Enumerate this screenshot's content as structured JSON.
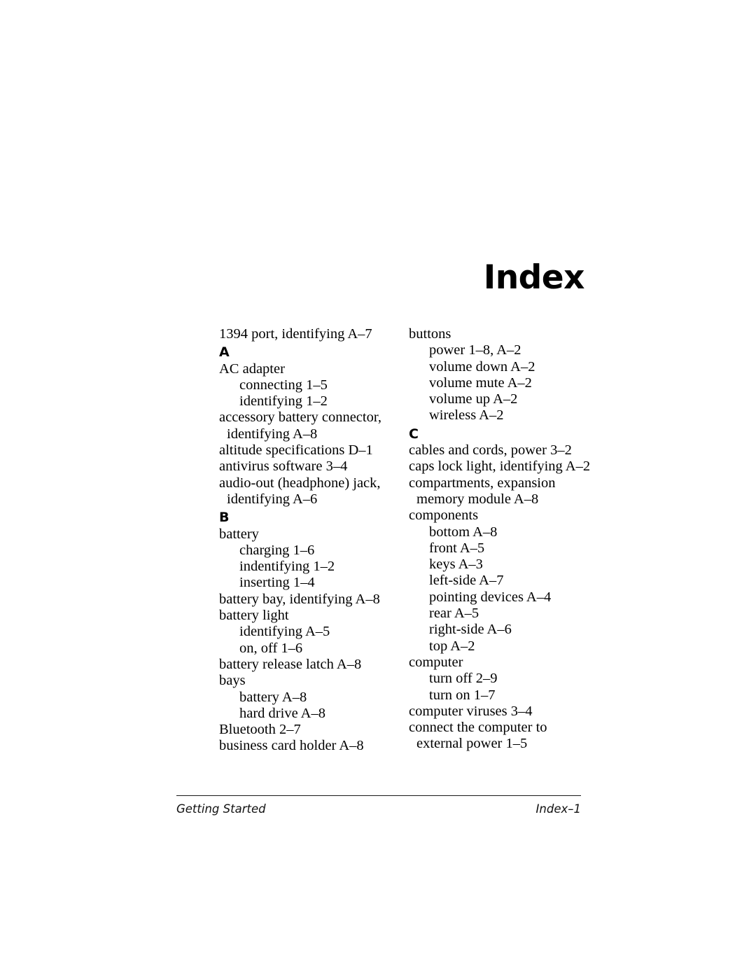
{
  "page": {
    "title": "Index",
    "document_name": "Getting Started",
    "page_number": "Index–1"
  },
  "index": {
    "columns": [
      {
        "name": "left",
        "blocks": [
          {
            "kind": "entry",
            "level": "main",
            "text": "1394 port, identifying A–7"
          },
          {
            "kind": "heading",
            "text": "A"
          },
          {
            "kind": "entry",
            "level": "main",
            "text": "AC adapter"
          },
          {
            "kind": "entry",
            "level": "sub",
            "text": "connecting 1–5"
          },
          {
            "kind": "entry",
            "level": "sub",
            "text": "identifying 1–2"
          },
          {
            "kind": "entry",
            "level": "main",
            "text": "accessory battery connector, identifying A–8"
          },
          {
            "kind": "entry",
            "level": "main",
            "text": "altitude specifications D–1"
          },
          {
            "kind": "entry",
            "level": "main",
            "text": "antivirus software 3–4"
          },
          {
            "kind": "entry",
            "level": "main",
            "text": "audio-out (headphone) jack, identifying A–6"
          },
          {
            "kind": "heading",
            "text": "B"
          },
          {
            "kind": "entry",
            "level": "main",
            "text": "battery"
          },
          {
            "kind": "entry",
            "level": "sub",
            "text": "charging 1–6"
          },
          {
            "kind": "entry",
            "level": "sub",
            "text": "indentifying 1–2"
          },
          {
            "kind": "entry",
            "level": "sub",
            "text": "inserting 1–4"
          },
          {
            "kind": "entry",
            "level": "main",
            "text": "battery bay, identifying A–8"
          },
          {
            "kind": "entry",
            "level": "main",
            "text": "battery light"
          },
          {
            "kind": "entry",
            "level": "sub",
            "text": "identifying A–5"
          },
          {
            "kind": "entry",
            "level": "sub",
            "text": "on, off 1–6"
          },
          {
            "kind": "entry",
            "level": "main",
            "text": "battery release latch A–8"
          },
          {
            "kind": "entry",
            "level": "main",
            "text": "bays"
          },
          {
            "kind": "entry",
            "level": "sub",
            "text": "battery A–8"
          },
          {
            "kind": "entry",
            "level": "sub",
            "text": "hard drive A–8"
          },
          {
            "kind": "entry",
            "level": "main",
            "text": "Bluetooth 2–7"
          },
          {
            "kind": "entry",
            "level": "main",
            "text": "business card holder A–8"
          }
        ]
      },
      {
        "name": "right",
        "blocks": [
          {
            "kind": "entry",
            "level": "main",
            "text": "buttons"
          },
          {
            "kind": "entry",
            "level": "sub",
            "text": "power 1–8, A–2"
          },
          {
            "kind": "entry",
            "level": "sub",
            "text": "volume down A–2"
          },
          {
            "kind": "entry",
            "level": "sub",
            "text": "volume mute A–2"
          },
          {
            "kind": "entry",
            "level": "sub",
            "text": "volume up A–2"
          },
          {
            "kind": "entry",
            "level": "sub",
            "text": "wireless A–2"
          },
          {
            "kind": "heading",
            "text": "C"
          },
          {
            "kind": "entry",
            "level": "main",
            "text": "cables and cords, power 3–2"
          },
          {
            "kind": "entry",
            "level": "main",
            "text": "caps lock light, identifying A–2"
          },
          {
            "kind": "entry",
            "level": "main",
            "text": "compartments, expansion memory module A–8"
          },
          {
            "kind": "entry",
            "level": "main",
            "text": "components"
          },
          {
            "kind": "entry",
            "level": "sub",
            "text": "bottom A–8"
          },
          {
            "kind": "entry",
            "level": "sub",
            "text": "front A–5"
          },
          {
            "kind": "entry",
            "level": "sub",
            "text": "keys A–3"
          },
          {
            "kind": "entry",
            "level": "sub",
            "text": "left-side A–7"
          },
          {
            "kind": "entry",
            "level": "sub",
            "text": "pointing devices A–4"
          },
          {
            "kind": "entry",
            "level": "sub",
            "text": "rear A–5"
          },
          {
            "kind": "entry",
            "level": "sub",
            "text": "right-side A–6"
          },
          {
            "kind": "entry",
            "level": "sub",
            "text": "top A–2"
          },
          {
            "kind": "entry",
            "level": "main",
            "text": "computer"
          },
          {
            "kind": "entry",
            "level": "sub",
            "text": "turn off 2–9"
          },
          {
            "kind": "entry",
            "level": "sub",
            "text": "turn on 1–7"
          },
          {
            "kind": "entry",
            "level": "main",
            "text": "computer viruses 3–4"
          },
          {
            "kind": "entry",
            "level": "main",
            "text": "connect the computer to external power 1–5"
          }
        ]
      }
    ]
  }
}
